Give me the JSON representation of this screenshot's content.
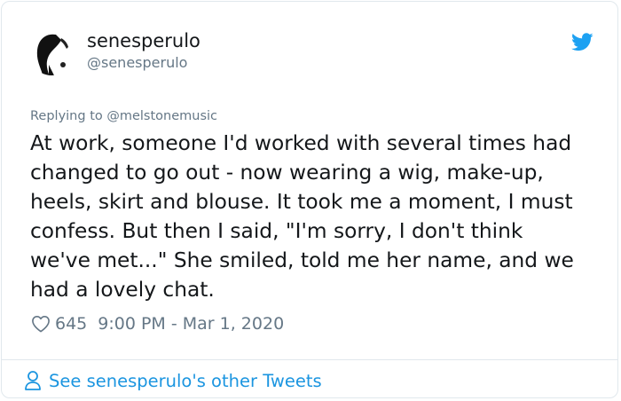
{
  "author": {
    "display_name": "senesperulo",
    "handle": "@senesperulo",
    "avatar_icon": "avatar-silhouette"
  },
  "brand": {
    "icon": "twitter-bird-icon",
    "color": "#1da1f2"
  },
  "reply": {
    "prefix": "Replying to",
    "mention": "@melstonemusic"
  },
  "tweet": {
    "lines": [
      "At work, someone I'd worked with several times had",
      "changed to go out - now wearing a wig, make-up,",
      "heels, skirt and blouse. It took me a moment, I must",
      "confess. But then I said, \"I'm sorry, I don't think",
      "we've met...\" She smiled, told me her name, and we",
      "had a lovely chat."
    ]
  },
  "meta": {
    "likes": "645",
    "timestamp": "9:00 PM - Mar 1, 2020",
    "like_icon": "heart-icon"
  },
  "footer": {
    "link_text": "See senesperulo's other Tweets",
    "icon": "person-icon",
    "link_color": "#1b95e0"
  },
  "colors": {
    "text": "#14171a",
    "secondary": "#657786",
    "border": "#e1e8ed"
  }
}
